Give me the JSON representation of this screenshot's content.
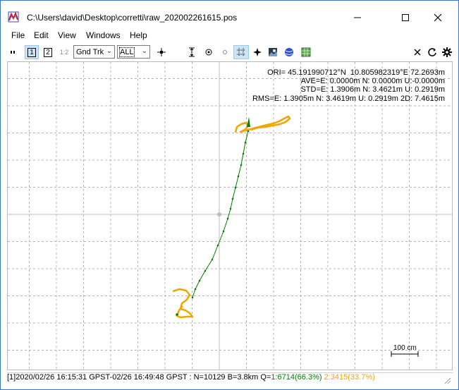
{
  "window": {
    "title": "C:\\Users\\david\\Desktop\\corretti\\raw_202002261615.pos"
  },
  "menu": [
    "File",
    "Edit",
    "View",
    "Windows",
    "Help"
  ],
  "toolbar": {
    "solution1": "1",
    "solution2": "2",
    "solution12": "1:2",
    "plot_type": "Gnd Trk",
    "quality_filter": "ALL",
    "icons": [
      "toolbar-grip-icon",
      "center-origin-icon",
      "fit-vertical-icon",
      "fit-horizontal-icon",
      "show-point-icon",
      "grid-icon",
      "compass-icon",
      "map-image-icon",
      "globe-icon",
      "sky-image-icon",
      "close-icon",
      "refresh-icon",
      "settings-icon"
    ]
  },
  "info": {
    "ori": "ORI= 45.191990712°N  10.805982319°E 72.2693m",
    "ave": "AVE=E: 0.0000m N: 0.0000m U:-0.0000m",
    "std": "STD=E: 1.3906m N: 3.4621m U: 0.2919m",
    "rms": "RMS=E: 1.3905m N: 3.4619m U: 0.2919m 2D: 7.4615m"
  },
  "scale_label": "100 cm",
  "status": {
    "prefix": "[1]2020/02/26 16:15:31 GPST-02/26 16:49:48 GPST : N=10129 B=3.8km Q=",
    "q1": "1:6714(66.3%)",
    "q2": "2:3415(33.7%)"
  },
  "colors": {
    "fix": "#008000",
    "float": "#f0a500",
    "grid": "#b4b4b4",
    "accent": "#3a75c4"
  }
}
